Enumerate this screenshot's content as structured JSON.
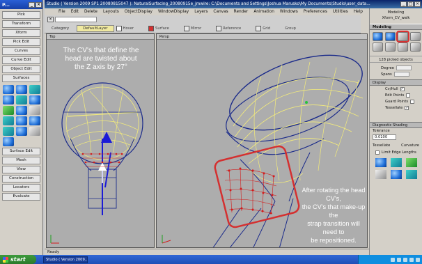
{
  "palette": {
    "title": "P...",
    "buttons": [
      "Pick",
      "Transform",
      "Xform",
      "Pick Edit",
      "Curves",
      "Curve Edit",
      "Object Edit",
      "Surfaces",
      "Surface Edit",
      "Mesh",
      "View",
      "Construction",
      "Locators",
      "Evaluate"
    ]
  },
  "window": {
    "title": "Studio ( Version 2009 SP1  20080815047 ): NaturalSurfacing_20080915e_jmwire: C:\\Documents and Settings\\Joshua Marusko\\My Documents\\Studio\\user_data..."
  },
  "menu": [
    "File",
    "Edit",
    "Delete",
    "Layouts",
    "ObjectDisplay",
    "WindowDisplay",
    "Layers",
    "Canvas",
    "Render",
    "Animation",
    "Windows",
    "Preferences",
    "Utilities",
    "Help"
  ],
  "shelf": {
    "tabs": [
      "Category",
      "DefaultLayer"
    ],
    "items": [
      "Hover",
      "Surface",
      "Mirror",
      "Reference",
      "Grid",
      "Group"
    ]
  },
  "viewports": {
    "left_title": "Top",
    "right_title": "Persp"
  },
  "callouts": {
    "left": "The CV's that define the\nhead are twisted about\nthe Z axis by 27°",
    "right": "After rotating the head CV's,\nthe CV's that make-up the\nstrap transition will need to\nbe repositioned."
  },
  "status": "Ready",
  "right_panel": {
    "header_line1": "Modeling",
    "header_line2": "Xform_CV_walk",
    "section_modeling": "Modeling",
    "count": "128 picked objects",
    "field1": "Degree",
    "field2": "Spans",
    "section_display": "Display",
    "checks": [
      "Cv/Hull",
      "Edit Points",
      "Guard Points",
      "Tessellate"
    ],
    "section_shading": "Diagnostic Shading",
    "tolerance_label": "Tolerance",
    "tolerance_value": "0.0100",
    "tes_left": "Tessellate",
    "tes_right": "Curvature",
    "edge_label": "Limit Edge Lengths"
  },
  "taskbar": {
    "start": "start",
    "task_item": "Studio ( Version 2009..."
  },
  "colors": {
    "wire_yellow": "#f4ec7a",
    "wire_blue": "#1a2a8a",
    "cv_red": "#d21c1c",
    "callout_border": "#d43030"
  }
}
